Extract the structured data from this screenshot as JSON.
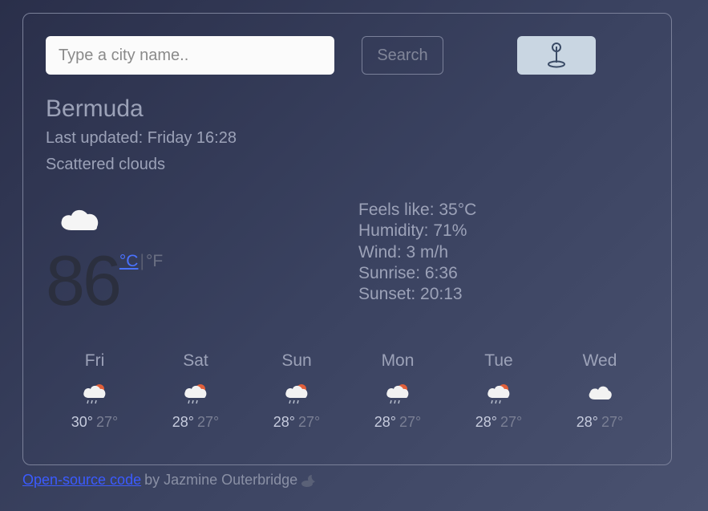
{
  "search": {
    "placeholder": "Type a city name..",
    "button": "Search"
  },
  "location": {
    "name": "Bermuda",
    "updated_label": "Last updated: Friday 16:28",
    "condition": "Scattered clouds"
  },
  "current": {
    "temp": "86",
    "unit_c": "°C",
    "unit_sep": "|",
    "unit_f": "°F"
  },
  "details": {
    "feels": "Feels like: 35°C",
    "humidity": "Humidity: 71%",
    "wind": "Wind: 3 m/h",
    "sunrise": "Sunrise: 6:36",
    "sunset": "Sunset: 20:13"
  },
  "forecast": [
    {
      "day": "Fri",
      "icon": "sun-rain",
      "hi": "30°",
      "lo": "27°"
    },
    {
      "day": "Sat",
      "icon": "sun-rain",
      "hi": "28°",
      "lo": "27°"
    },
    {
      "day": "Sun",
      "icon": "sun-rain",
      "hi": "28°",
      "lo": "27°"
    },
    {
      "day": "Mon",
      "icon": "sun-rain",
      "hi": "28°",
      "lo": "27°"
    },
    {
      "day": "Tue",
      "icon": "sun-rain",
      "hi": "28°",
      "lo": "27°"
    },
    {
      "day": "Wed",
      "icon": "cloud",
      "hi": "28°",
      "lo": "27°"
    }
  ],
  "footer": {
    "link": "Open-source code",
    "rest": " by Jazmine Outerbridge "
  }
}
